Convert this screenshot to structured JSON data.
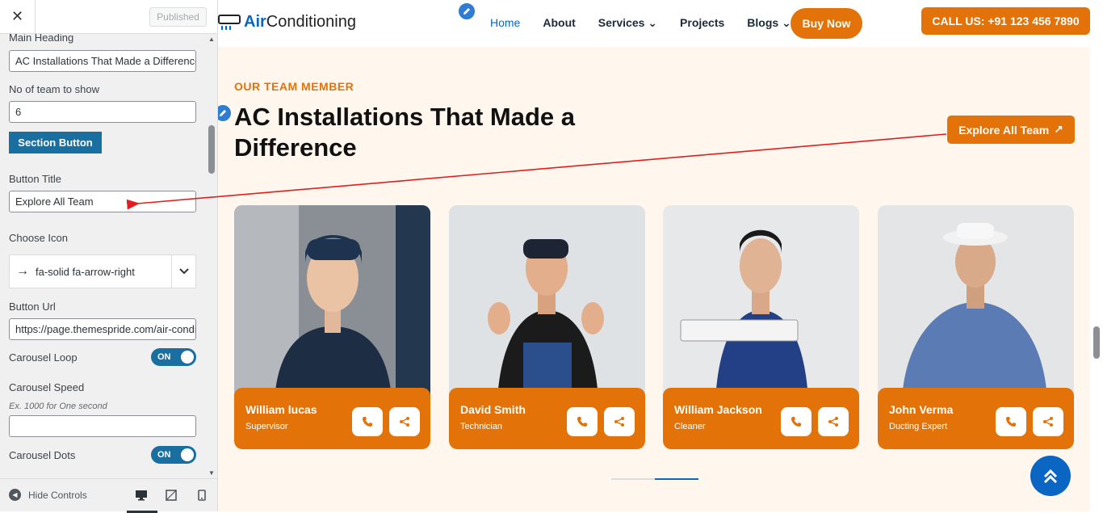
{
  "customizer": {
    "close_label": "✕",
    "published_label": "Published",
    "fields": {
      "main_heading_label": "Main Heading",
      "main_heading_value": "AC Installations That Made a Difference",
      "team_count_label": "No of team to show",
      "team_count_value": "6",
      "section_button_label": "Section Button",
      "button_title_label": "Button Title",
      "button_title_value": "Explore All Team",
      "choose_icon_label": "Choose Icon",
      "choose_icon_value": "fa-solid fa-arrow-right",
      "button_url_label": "Button Url",
      "button_url_value": "https://page.themespride.com/air-conditioning",
      "carousel_loop_label": "Carousel Loop",
      "carousel_loop_state": "ON",
      "carousel_speed_label": "Carousel Speed",
      "carousel_speed_hint": "Ex. 1000 for One second",
      "carousel_speed_value": "",
      "carousel_dots_label": "Carousel Dots",
      "carousel_dots_state": "ON"
    },
    "footer": {
      "hide_controls_label": "Hide Controls"
    }
  },
  "site": {
    "logo": {
      "air": "Air",
      "rest": "Conditioning"
    },
    "menu": {
      "home": "Home",
      "about": "About",
      "services": "Services",
      "projects": "Projects",
      "blogs": "Blogs"
    },
    "buy_now": "Buy Now",
    "call_us": "CALL US: +91 123 456 7890"
  },
  "team_section": {
    "eyebrow": "OUR TEAM MEMBER",
    "heading": "AC Installations That Made a Difference",
    "explore_button": "Explore All Team",
    "members": [
      {
        "name": "William lucas",
        "role": "Supervisor"
      },
      {
        "name": "David Smith",
        "role": "Technician"
      },
      {
        "name": "William Jackson",
        "role": "Cleaner"
      },
      {
        "name": "John Verma",
        "role": "Ducting Expert"
      }
    ],
    "carousel_active_dot": 2
  },
  "colors": {
    "accent_orange": "#e37309",
    "brand_blue": "#0a66c2",
    "wp_blue": "#1a6fa1",
    "section_bg": "#fff6ee",
    "annotation_arrow": "#e41e1e"
  }
}
